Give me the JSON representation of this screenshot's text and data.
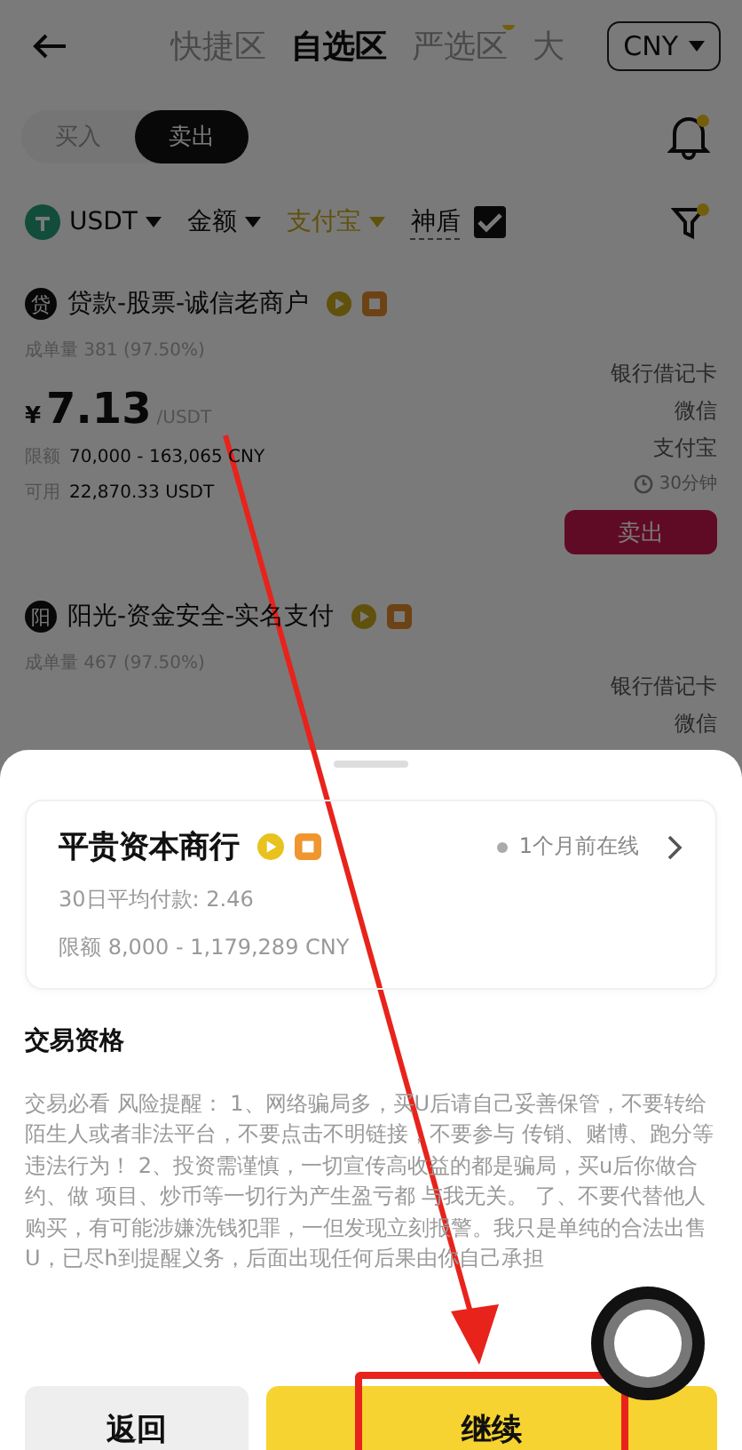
{
  "header": {
    "tabs": [
      {
        "label": "快捷区",
        "selected": false,
        "badge": false
      },
      {
        "label": "自选区",
        "selected": true,
        "badge": false
      },
      {
        "label": "严选区",
        "selected": false,
        "badge": true
      },
      {
        "label": "大",
        "selected": false,
        "badge": false
      }
    ],
    "currency": "CNY"
  },
  "side_tabs": [
    {
      "label": "买入",
      "selected": false
    },
    {
      "label": "卖出",
      "selected": true
    }
  ],
  "filters": {
    "coin": "USDT",
    "amount": "金额",
    "payment": "支付宝",
    "shield": {
      "label": "神盾",
      "checked": true
    }
  },
  "listings": [
    {
      "avatar": "贷",
      "name": "贷款-股票-诚信老商户",
      "orders_label": "成单量",
      "orders": "381 (97.50%)",
      "currency_symbol": "¥",
      "price": "7.13",
      "unit": "/USDT",
      "limit_label": "限额",
      "limit": "70,000 - 163,065 CNY",
      "available_label": "可用",
      "available": "22,870.33 USDT",
      "payments": [
        "银行借记卡",
        "微信",
        "支付宝"
      ],
      "time": "30分钟",
      "action": "卖出"
    },
    {
      "avatar": "阳",
      "name": "阳光-资金安全-实名支付",
      "orders_label": "成单量",
      "orders": "467 (97.50%)",
      "payments": [
        "银行借记卡",
        "微信"
      ]
    }
  ],
  "sheet": {
    "merchant": {
      "name": "平贵资本商行",
      "status": "1个月前在线",
      "avg_pay": "30日平均付款: 2.46",
      "limit": "限额 8,000 - 1,179,289 CNY"
    },
    "section_title": "交易资格",
    "notice": "交易必看 风险提醒： 1、网络骗局多，买U后请自己妥善保管，不要转给陌生人或者非法平台，不要点击不明链接，不要参与 传销、赌博、跑分等违法行为！ 2、投资需谨慎，一切宣传高收益的都是骗局，买u后你做合约、做 项目、炒币等一切行为产生盈亏都 与我无关。 了、不要代替他人购买，有可能涉嫌洗钱犯罪，一但发现立刻报警。我只是单纯的合法出售U，已尽h到提醒义务，后面出现任何后果由你自己承担",
    "buttons": [
      {
        "label": "返回",
        "kind": "secondary"
      },
      {
        "label": "继续",
        "kind": "primary"
      }
    ]
  }
}
